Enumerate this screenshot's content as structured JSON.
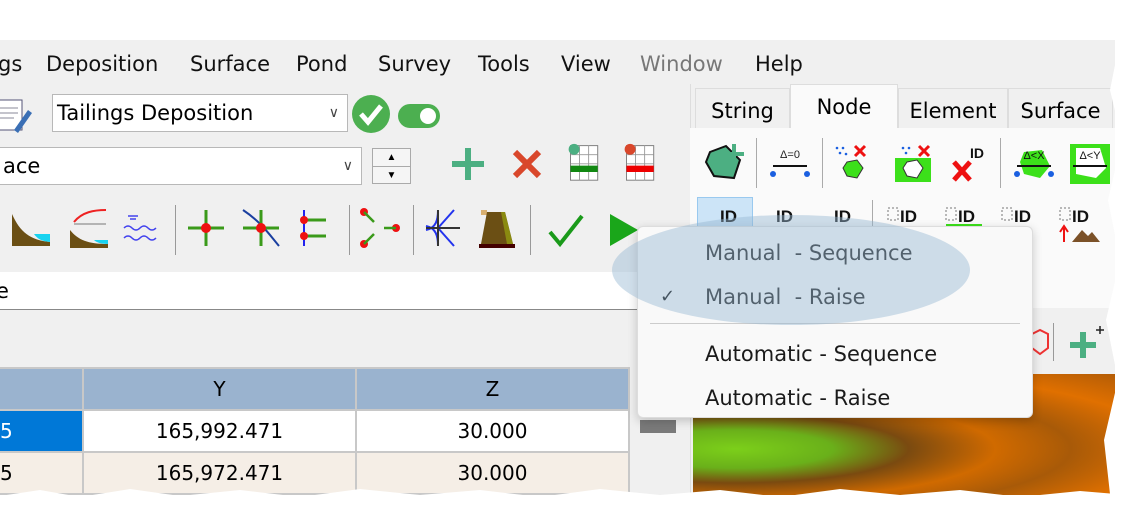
{
  "menubar": {
    "items": [
      "gs",
      "Deposition",
      "Surface",
      "Pond",
      "Survey",
      "Tools",
      "View",
      "Window",
      "Help"
    ],
    "disabled": [
      "Window"
    ]
  },
  "toolbar": {
    "mode_select": "Tailings Deposition",
    "surface_select": "ace",
    "filter_field": "e",
    "toggle_on": true
  },
  "tabs": [
    {
      "label": "String"
    },
    {
      "label": "Node",
      "active": true
    },
    {
      "label": "Element"
    },
    {
      "label": "Surface"
    }
  ],
  "node_toolbar": {
    "labels": [
      "Δ=0",
      "ID",
      "Δ<X",
      "Δ<Y"
    ]
  },
  "dropdown": {
    "items": [
      {
        "label": "Manual  - Sequence",
        "checked": false
      },
      {
        "label": "Manual  - Raise",
        "checked": true
      },
      {
        "label": "Automatic - Sequence",
        "checked": false
      },
      {
        "label": "Automatic - Raise",
        "checked": false
      }
    ],
    "check_glyph": "✓"
  },
  "table": {
    "headers": [
      "",
      "Y",
      "Z"
    ],
    "rows": [
      [
        "5",
        "165,992.471",
        "30.000"
      ],
      [
        "5",
        "165,972.471",
        "30.000"
      ]
    ]
  },
  "colors": {
    "accent": "#0078d7",
    "header": "#9ab3cf",
    "green": "#4caf50",
    "red": "#d9472b"
  }
}
